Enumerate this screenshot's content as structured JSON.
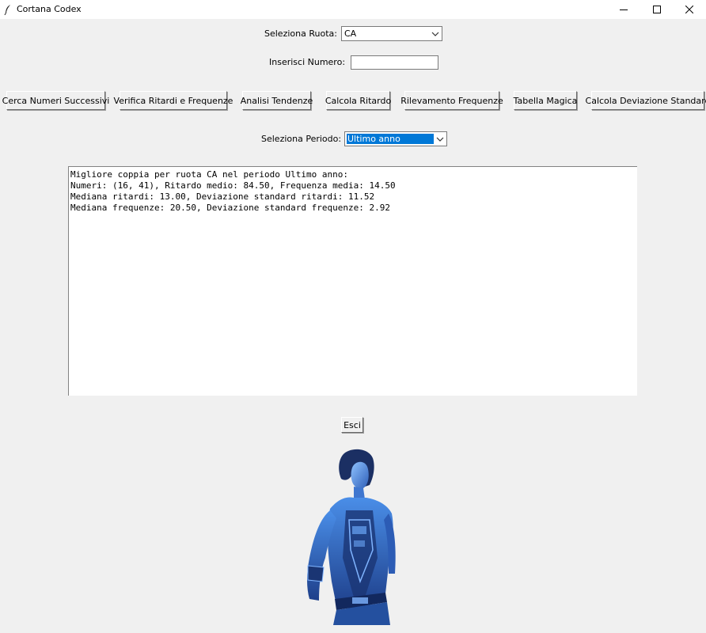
{
  "window": {
    "title": "Cortana Codex",
    "icon": "feather-icon",
    "controls": [
      "minimize-icon",
      "maximize-icon",
      "close-icon"
    ]
  },
  "ruota": {
    "label": "Seleziona Ruota:",
    "value": "CA"
  },
  "numero": {
    "label": "Inserisci Numero:",
    "value": ""
  },
  "buttons": [
    "Cerca Numeri Successivi",
    "Verifica Ritardi e Frequenze",
    "Analisi Tendenze",
    "Calcola Ritardo",
    "Rilevamento Frequenze",
    "Tabella Magica",
    "Calcola Deviazione Standard"
  ],
  "periodo": {
    "label": "Seleziona Periodo:",
    "value": "Ultimo anno"
  },
  "output": {
    "lines": [
      "Migliore coppia per ruota CA nel periodo Ultimo anno:",
      "Numeri: (16, 41), Ritardo medio: 84.50, Frequenza media: 14.50",
      "Mediana ritardi: 13.00, Deviazione standard ritardi: 11.52",
      "Mediana frequenze: 20.50, Deviazione standard frequenze: 2.92"
    ]
  },
  "exit_label": "Esci",
  "colors": {
    "selection": "#0078d7",
    "hologram": "#3a78d0"
  }
}
